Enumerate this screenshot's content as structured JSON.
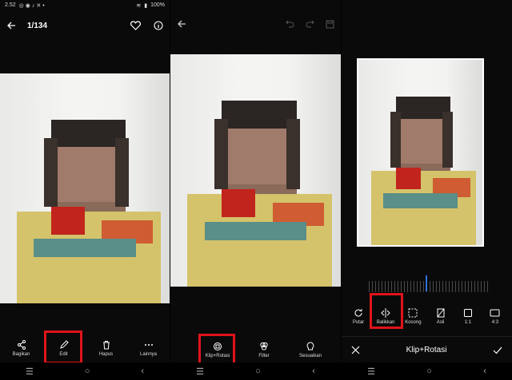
{
  "status_bar": {
    "time": "2.52",
    "battery": "100%"
  },
  "viewer": {
    "counter": "1/134",
    "actions": [
      {
        "label": "Bagikan",
        "icon": "share-icon"
      },
      {
        "label": "Edit",
        "icon": "pencil-icon"
      },
      {
        "label": "Hapus",
        "icon": "trash-icon"
      },
      {
        "label": "Lainnya",
        "icon": "more-icon"
      }
    ]
  },
  "editor": {
    "tools": [
      {
        "label": "Klip+Rotasi",
        "icon": "crop-rotate-icon"
      },
      {
        "label": "Filter",
        "icon": "filter-icon"
      },
      {
        "label": "Sesuaikan",
        "icon": "adjust-icon"
      }
    ]
  },
  "crop": {
    "title": "Klip+Rotasi",
    "tools": [
      {
        "label": "Putar",
        "icon": "rotate-icon"
      },
      {
        "label": "Balikkan",
        "icon": "flip-icon"
      },
      {
        "label": "Kosong",
        "icon": "free-crop-icon"
      },
      {
        "label": "Asli",
        "icon": "original-ratio-icon"
      },
      {
        "label": "1:1",
        "icon": "square-ratio-icon"
      },
      {
        "label": "4:3",
        "icon": "ratio-4-3-icon"
      }
    ]
  },
  "colors": {
    "highlight": "#e0131a",
    "accent": "#2f6fd8"
  }
}
